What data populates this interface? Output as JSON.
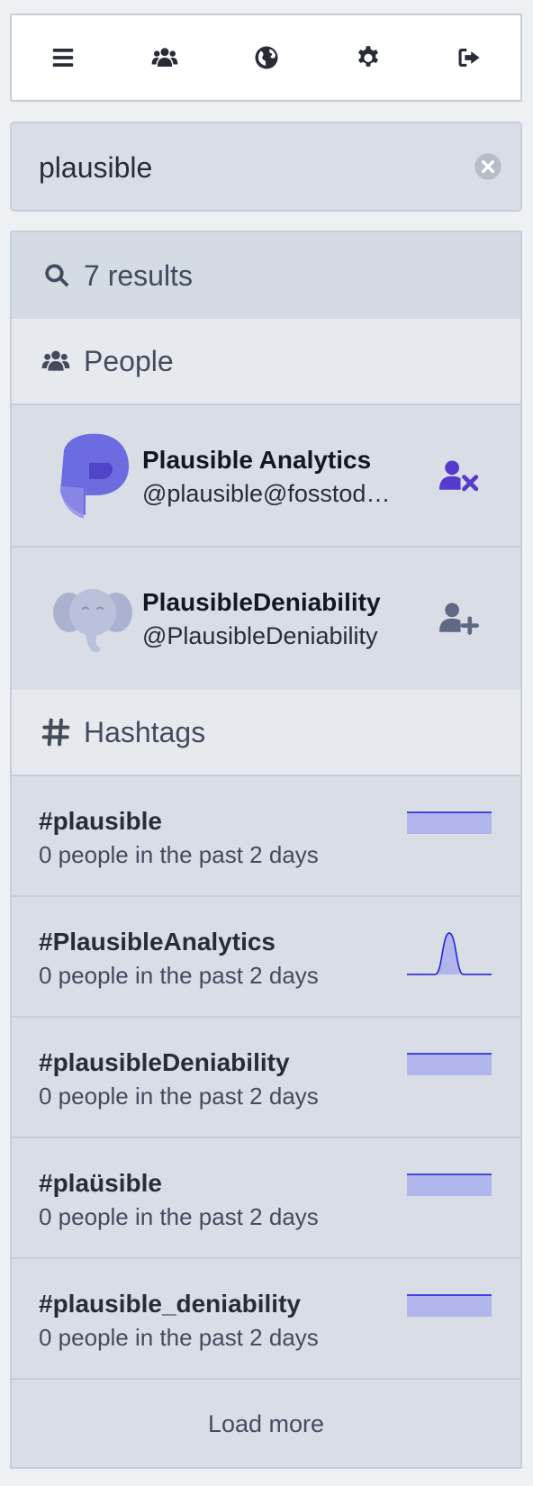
{
  "nav": {
    "items": [
      "menu-icon",
      "people-icon",
      "globe-icon",
      "settings-icon",
      "logout-icon"
    ]
  },
  "search": {
    "value": "plausible"
  },
  "results": {
    "summary": "7 results",
    "people_heading": "People",
    "hashtags_heading": "Hashtags",
    "accounts": [
      {
        "name": "Plausible Analytics",
        "handle": "@plausible@fosstodon.org",
        "action": "unfollow"
      },
      {
        "name": "PlausibleDeniability",
        "handle": "@PlausibleDeniability",
        "action": "follow"
      }
    ],
    "hashtags": [
      {
        "tag": "#plausible",
        "meta": "0 people in the past 2 days",
        "trend": [
          0,
          0,
          0,
          0,
          0,
          0,
          0
        ]
      },
      {
        "tag": "#PlausibleAnalytics",
        "meta": "0 people in the past 2 days",
        "trend": [
          0,
          0,
          0,
          1,
          0,
          0,
          0
        ]
      },
      {
        "tag": "#plausibleDeniability",
        "meta": "0 people in the past 2 days",
        "trend": [
          0,
          0,
          0,
          0,
          0,
          0,
          0
        ]
      },
      {
        "tag": "#plaüsible",
        "meta": "0 people in the past 2 days",
        "trend": [
          0,
          0,
          0,
          0,
          0,
          0,
          0
        ]
      },
      {
        "tag": "#plausible_deniability",
        "meta": "0 people in the past 2 days",
        "trend": [
          0,
          0,
          0,
          0,
          0,
          0,
          0
        ]
      }
    ],
    "load_more": "Load more"
  },
  "colors": {
    "accent": "#563acc",
    "follow_gray": "#606984",
    "spark_line": "#1a1adb",
    "spark_fill": "#b0b5ec"
  }
}
